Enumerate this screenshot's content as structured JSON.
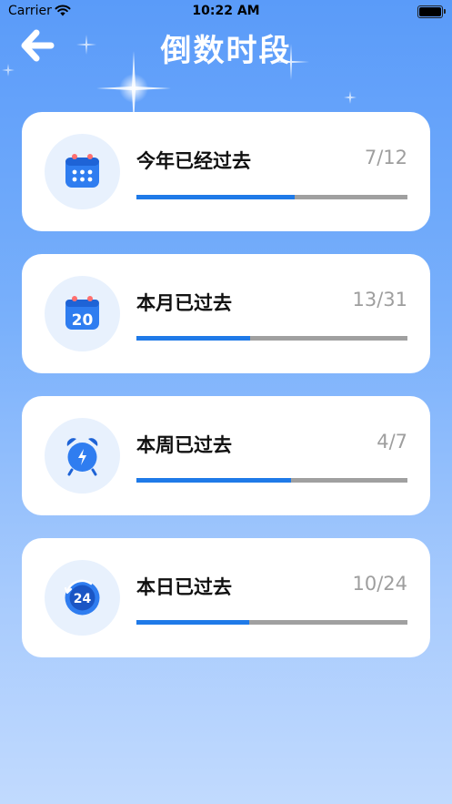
{
  "status_bar": {
    "carrier": "Carrier",
    "time": "10:22 AM"
  },
  "header": {
    "title": "倒数时段",
    "back_icon": "arrow-left-icon"
  },
  "colors": {
    "accent": "#1f7ae8",
    "track": "#a0a0a0",
    "count_text": "#9e9e9e"
  },
  "cards": [
    {
      "label": "今年已经过去",
      "count": "7/12",
      "progress": 0.583,
      "icon": "calendar-grid-icon"
    },
    {
      "label": "本月已过去",
      "count": "13/31",
      "progress": 0.419,
      "icon": "calendar-date-icon",
      "icon_text": "20"
    },
    {
      "label": "本周已过去",
      "count": "4/7",
      "progress": 0.571,
      "icon": "alarm-clock-icon"
    },
    {
      "label": "本日已过去",
      "count": "10/24",
      "progress": 0.417,
      "icon": "24-hour-clock-icon",
      "icon_text": "24"
    }
  ]
}
